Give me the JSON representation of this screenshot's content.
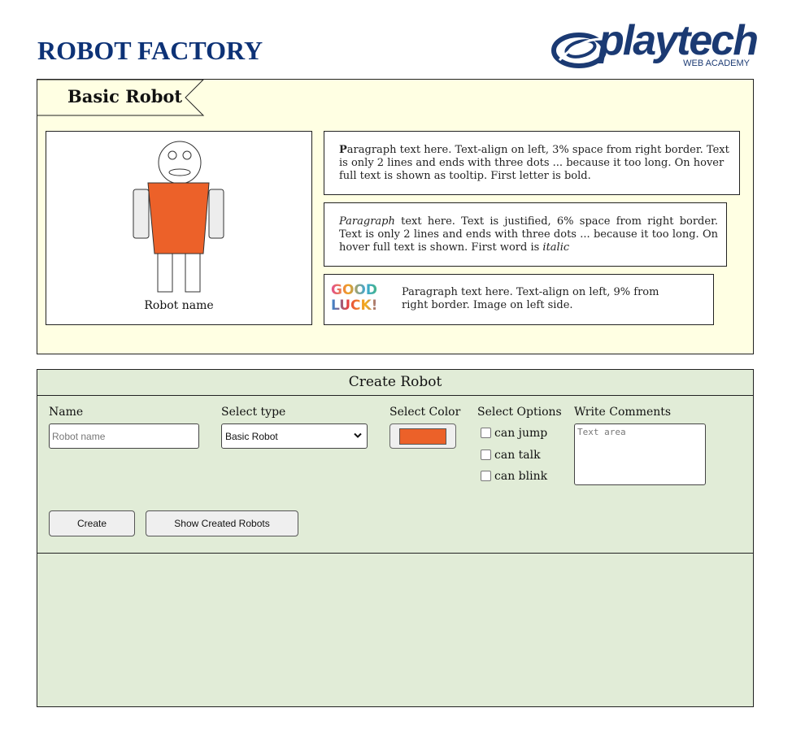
{
  "header": {
    "title": "ROBOT FACTORY",
    "logo_word": "playtech",
    "logo_sub": "WEB ACADEMY"
  },
  "basic_robot": {
    "title": "Basic Robot",
    "robot_name": "Robot name",
    "robot_color": "#ec6129",
    "paragraphs": {
      "p1_first_letter": "P",
      "p1_rest": "aragraph text here. Text-align on left, 3% space from right border. Text is only 2 lines and ends with three dots ... because it too long. On hover full text is shown as tooltip. First letter is bold.",
      "p2_first_word": "Paragraph",
      "p2_rest": " text here. Text is justified, 6% space from right border. Text is only 2 lines and ends with three dots ... because it too long. On hover full text is shown. First word is ",
      "p2_last": "italic",
      "p3": "Paragraph text here. Text-align on left, 9% from right border. Image on left side.",
      "image_line1": "GOOD",
      "image_line2": "LUCK!"
    }
  },
  "create_robot": {
    "title": "Create Robot",
    "name_label": "Name",
    "name_placeholder": "Robot name",
    "type_label": "Select type",
    "type_selected": "Basic Robot",
    "color_label": "Select Color",
    "selected_color": "#ec6129",
    "options_label": "Select Options",
    "options": [
      {
        "label": "can jump",
        "checked": false
      },
      {
        "label": "can talk",
        "checked": false
      },
      {
        "label": "can blink",
        "checked": false
      }
    ],
    "comments_label": "Write Comments",
    "comments_placeholder": "Text area",
    "create_button": "Create",
    "show_button": "Show Created Robots"
  },
  "colors": {
    "title_blue": "#0d3276",
    "panel_yellow": "#ffffe3",
    "panel_green": "#e1ecd7",
    "robot_orange": "#ec6129"
  }
}
